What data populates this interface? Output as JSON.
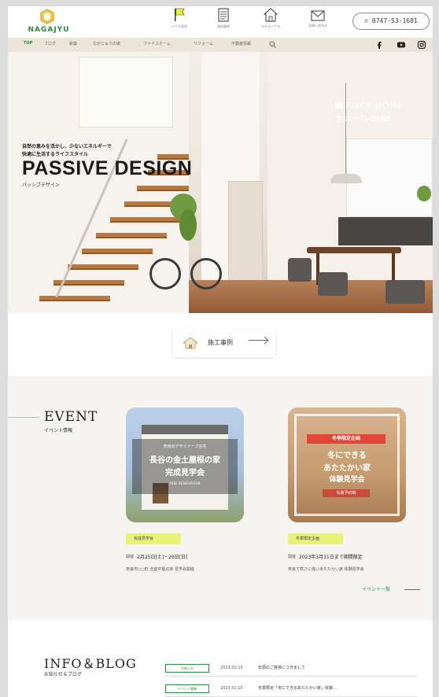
{
  "brand": {
    "name": "NAGAJYU",
    "color": "#2a8a3a"
  },
  "header": {
    "nav": [
      {
        "label": "ハウス見学",
        "icon": "flag-icon"
      },
      {
        "label": "資料請求",
        "icon": "document-icon"
      },
      {
        "label": "モデルハウス",
        "icon": "house-icon"
      },
      {
        "label": "お問い合わせ",
        "icon": "mail-icon"
      }
    ],
    "phone": "0747-53-1681"
  },
  "navbar": {
    "items": [
      "TOP",
      "ブログ",
      "新築",
      "ながじゅうの家",
      "ファイスホーム",
      "リフォーム",
      "不動産情報"
    ],
    "search_icon": "search-icon",
    "social": [
      "facebook-icon",
      "youtube-icon",
      "instagram-icon"
    ]
  },
  "hero": {
    "brand": "FIACE HOME",
    "brand_sub": "サステナブルな住環境",
    "catch": "自然の恵みを活かし、少ないエネルギーで\n快適に生活するライフスタイル",
    "title": "PASSIVE DESIGN",
    "title_ruby": "パッシブデザイン"
  },
  "works": {
    "label": "施工事例"
  },
  "event": {
    "heading": "EVENT",
    "sub": "イベント情報",
    "cards": [
      {
        "tag": "完成見学会",
        "date_label": "開催",
        "date": "2月25日[土]・26日[日]",
        "desc": "奈良市○○町 全室平屋の家 見学会開催",
        "img_lines": [
          "奈良のデザイナーズ住宅",
          "長谷の金土屋根の家",
          "完成見学会"
        ],
        "img_small": "FREE RESERVATION"
      },
      {
        "tag": "冬季限定企画",
        "date_label": "開催",
        "date": "2023年3月31日まで期間限定",
        "desc": "奈良で寒さに強いあたたかい家 体験見学会",
        "img_lines": [
          "冬季限定企画",
          "冬にできる",
          "あたたかい家",
          "体験見学会"
        ],
        "img_small": "先着予約制"
      }
    ],
    "more": "イベント一覧"
  },
  "info": {
    "heading": "INFO＆BLOG",
    "sub": "お知らせ＆ブログ",
    "rows": [
      {
        "category": "お知らせ",
        "date": "2023.02.15",
        "title": "年頭のご挨拶につきまして"
      },
      {
        "category": "イベント情報",
        "date": "2023.01.15",
        "title": "冬季限定「冬にできるあたたかい家」体験…"
      }
    ]
  }
}
